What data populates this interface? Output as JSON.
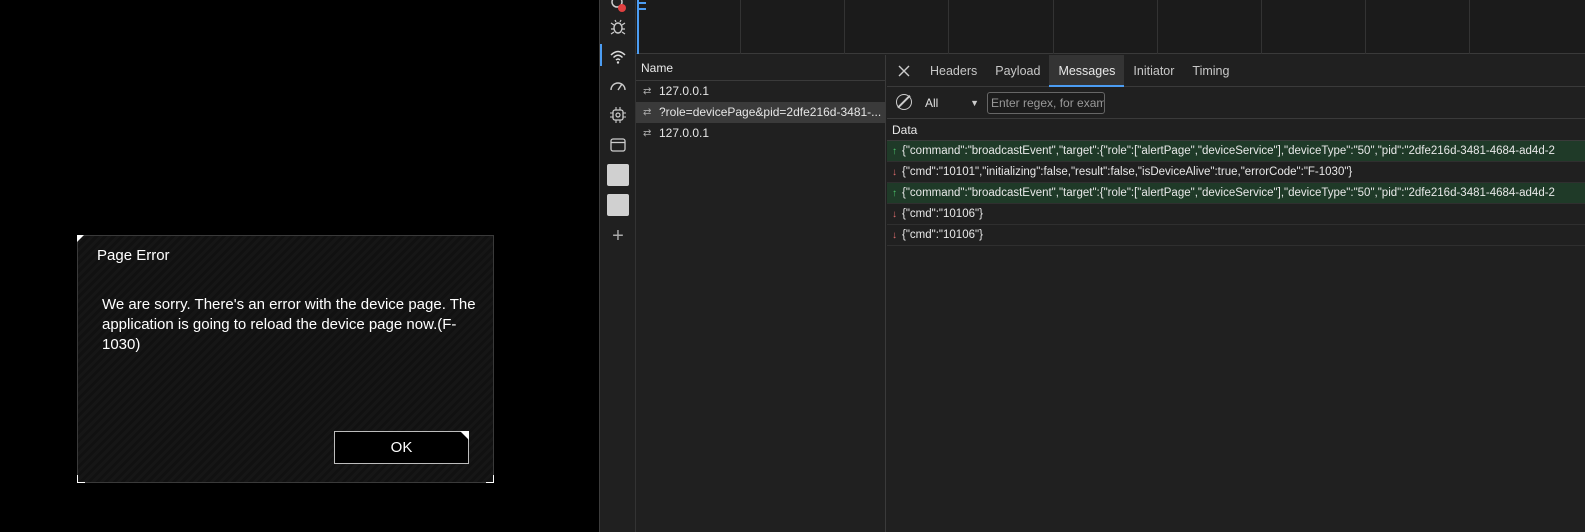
{
  "dialog": {
    "title": "Page Error",
    "message": "We are sorry. There's an error with the device page. The application is going to reload the device page now.(F-1030)",
    "ok_label": "OK"
  },
  "devtools": {
    "activity_icons": [
      "error-badge-icon",
      "bug-icon",
      "wifi-icon",
      "performance-gauge-icon",
      "cpu-icon",
      "application-window-icon",
      "square-icon",
      "square-icon",
      "plus-icon"
    ],
    "accent_color": "#4c9df3",
    "name_panel": {
      "header": "Name",
      "requests": [
        {
          "name": "127.0.0.1"
        },
        {
          "name": "?role=devicePage&pid=2dfe216d-3481-..."
        },
        {
          "name": "127.0.0.1"
        }
      ]
    },
    "tabs": [
      {
        "label": "Headers"
      },
      {
        "label": "Payload"
      },
      {
        "label": "Messages"
      },
      {
        "label": "Initiator"
      },
      {
        "label": "Timing"
      }
    ],
    "active_tab": "Messages",
    "filter": {
      "type_value": "All",
      "regex_placeholder": "Enter regex, for example"
    },
    "data_header": "Data",
    "messages": [
      {
        "direction": "sent",
        "text": "{\"command\":\"broadcastEvent\",\"target\":{\"role\":[\"alertPage\",\"deviceService\"],\"deviceType\":\"50\",\"pid\":\"2dfe216d-3481-4684-ad4d-2"
      },
      {
        "direction": "received",
        "text": "{\"cmd\":\"10101\",\"initializing\":false,\"result\":false,\"isDeviceAlive\":true,\"errorCode\":\"F-1030\"}"
      },
      {
        "direction": "sent",
        "text": "{\"command\":\"broadcastEvent\",\"target\":{\"role\":[\"alertPage\",\"deviceService\"],\"deviceType\":\"50\",\"pid\":\"2dfe216d-3481-4684-ad4d-2"
      },
      {
        "direction": "received",
        "text": "{\"cmd\":\"10106\"}"
      },
      {
        "direction": "received",
        "text": "{\"cmd\":\"10106\"}"
      }
    ]
  }
}
